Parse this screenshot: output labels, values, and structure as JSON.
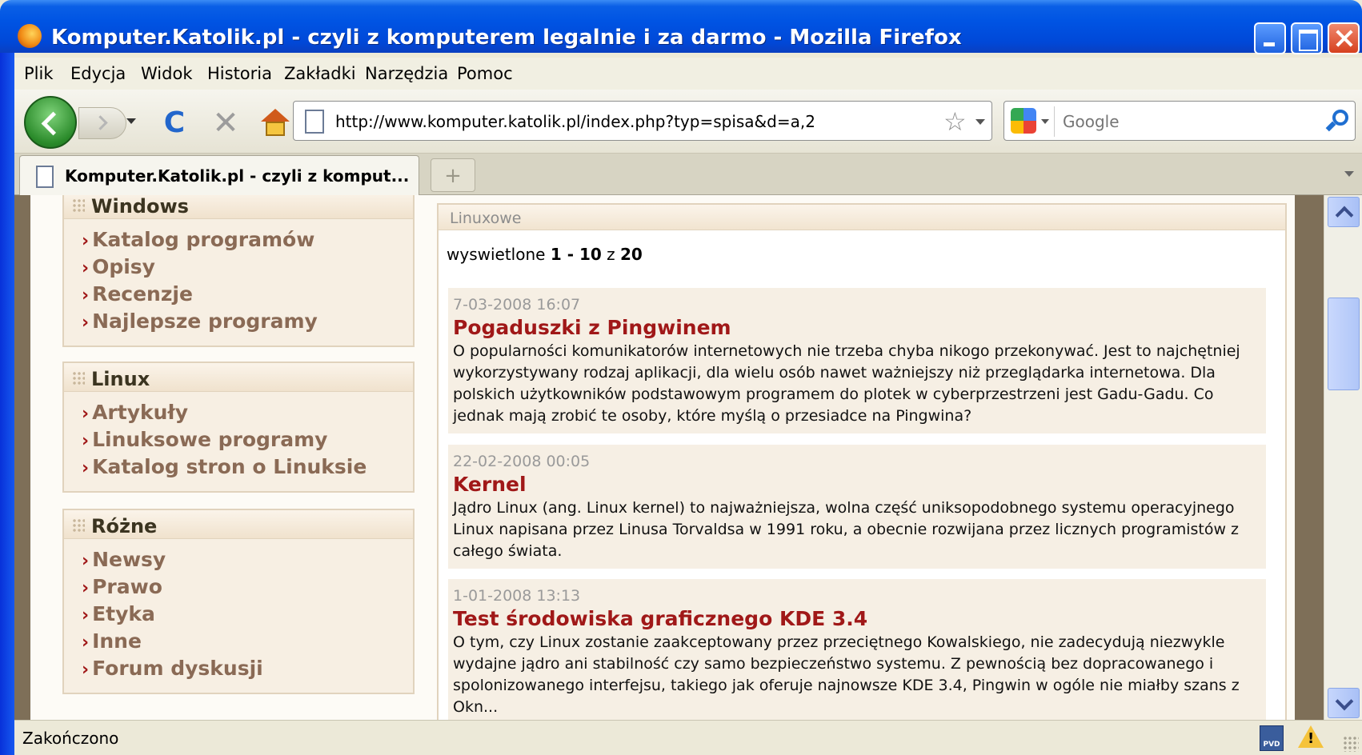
{
  "window": {
    "title": "Komputer.Katolik.pl - czyli z komputerem legalnie i za darmo - Mozilla Firefox"
  },
  "menu": [
    "Plik",
    "Edycja",
    "Widok",
    "Historia",
    "Zakładki",
    "Narzędzia",
    "Pomoc"
  ],
  "navbar": {
    "url": "http://www.komputer.katolik.pl/index.php?typ=spisa&d=a,2",
    "search_placeholder": "Google",
    "reload_glyph": "C",
    "stop_glyph": "✕",
    "star_glyph": "☆"
  },
  "tabs": {
    "active_label": "Komputer.Katolik.pl - czyli z komput...",
    "new_tab_glyph": "+"
  },
  "sidebar": [
    {
      "title": "Windows",
      "items": [
        "Katalog programów",
        "Opisy",
        "Recenzje",
        "Najlepsze programy"
      ]
    },
    {
      "title": "Linux",
      "items": [
        "Artykuły",
        "Linuksowe programy",
        "Katalog stron o Linuksie"
      ]
    },
    {
      "title": "Różne",
      "items": [
        "Newsy",
        "Prawo",
        "Etyka",
        "Inne",
        "Forum dyskusji"
      ]
    }
  ],
  "main": {
    "section_label": "Linuxowe",
    "count": {
      "prefix": "wyswietlone",
      "range": "1 - 10",
      "sep": "z",
      "total": "20"
    },
    "articles": [
      {
        "date": "7-03-2008 16:07",
        "title": "Pogaduszki z Pingwinem",
        "text": "O popularności komunikatorów internetowych nie trzeba chyba nikogo przekonywać. Jest to najchętniej wykorzystywany rodzaj aplikacji, dla wielu osób nawet ważniejszy niż przeglądarka internetowa. Dla polskich użytkowników podstawowym programem do plotek w cyberprzestrzeni jest Gadu-Gadu. Co jednak mają zrobić te osoby, które myślą o przesiadce na Pingwina?"
      },
      {
        "date": "22-02-2008 00:05",
        "title": "Kernel",
        "text": "Jądro Linux (ang. Linux kernel) to najważniejsza, wolna część uniksopodobnego systemu operacyjnego Linux napisana przez Linusa Torvaldsa w 1991 roku, a obecnie rozwijana przez licznych programistów z całego świata."
      },
      {
        "date": "1-01-2008 13:13",
        "title": "Test środowiska graficznego KDE 3.4",
        "text": "O tym, czy Linux zostanie zaakceptowany przez przeciętnego Kowalskiego, nie zadecydują niezwykle wydajne jądro ani stabilność czy samo bezpieczeństwo systemu. Z pewnością bez dopracowanego i spolonizowanego interfejsu, takiego jak oferuje najnowsze KDE 3.4, Pingwin w ogóle nie miałby szans z Okn..."
      }
    ]
  },
  "status": {
    "text": "Zakończono",
    "pvd_label": "PVD"
  },
  "icons": {
    "sidebar_arrow": "›"
  }
}
